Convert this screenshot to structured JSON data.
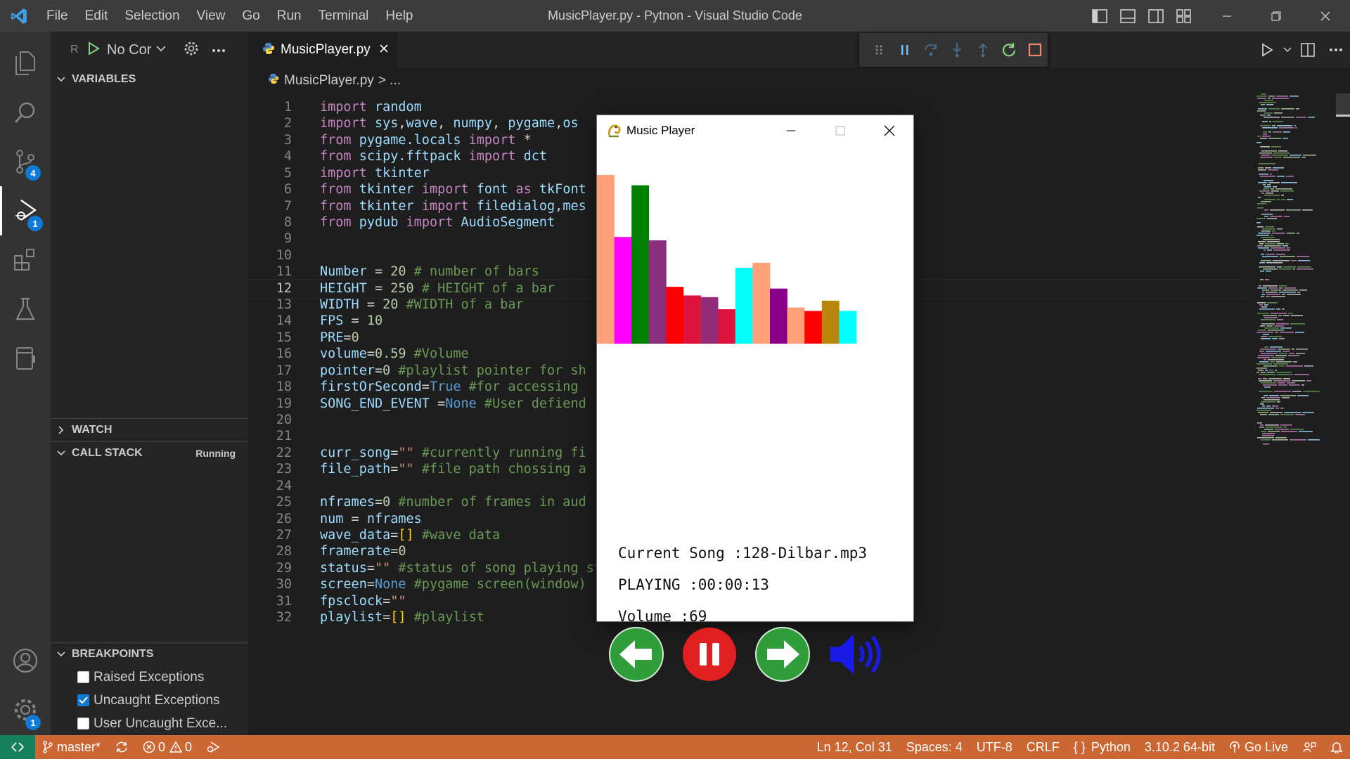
{
  "titlebar": {
    "menu": [
      "File",
      "Edit",
      "Selection",
      "View",
      "Go",
      "Run",
      "Terminal",
      "Help"
    ],
    "window_title": "MusicPlayer.py - Pytnon - Visual Studio Code"
  },
  "activity_bar": {
    "source_control_badge": "4",
    "run_debug_badge": "1",
    "manage_badge": "1"
  },
  "sidebar": {
    "run_prefix": "R",
    "run_config": "No Cor",
    "sections": {
      "variables": "VARIABLES",
      "watch": "WATCH",
      "call_stack": "CALL STACK",
      "call_stack_status": "Running",
      "breakpoints": "BREAKPOINTS"
    },
    "breakpoints": [
      {
        "label": "Raised Exceptions",
        "checked": false
      },
      {
        "label": "Uncaught Exceptions",
        "checked": true
      },
      {
        "label": "User Uncaught Exce...",
        "checked": false
      }
    ]
  },
  "editor": {
    "tab_label": "MusicPlayer.py",
    "breadcrumb_file": "MusicPlayer.py",
    "breadcrumb_rest": "> ...",
    "current_line": 12,
    "lines": [
      {
        "n": "1",
        "tokens": [
          [
            "kw",
            "import"
          ],
          [
            "op",
            " "
          ],
          [
            "id",
            "random"
          ]
        ]
      },
      {
        "n": "2",
        "tokens": [
          [
            "kw",
            "import"
          ],
          [
            "op",
            " "
          ],
          [
            "id",
            "sys"
          ],
          [
            "op",
            ","
          ],
          [
            "id",
            "wave"
          ],
          [
            "op",
            ", "
          ],
          [
            "id",
            "numpy"
          ],
          [
            "op",
            ", "
          ],
          [
            "id",
            "pygame"
          ],
          [
            "op",
            ","
          ],
          [
            "id",
            "os"
          ]
        ]
      },
      {
        "n": "3",
        "tokens": [
          [
            "kw",
            "from"
          ],
          [
            "op",
            " "
          ],
          [
            "id",
            "pygame.locals"
          ],
          [
            "op",
            " "
          ],
          [
            "kw",
            "import"
          ],
          [
            "op",
            " *"
          ]
        ]
      },
      {
        "n": "4",
        "tokens": [
          [
            "kw",
            "from"
          ],
          [
            "op",
            " "
          ],
          [
            "id",
            "scipy.fftpack"
          ],
          [
            "op",
            " "
          ],
          [
            "kw",
            "import"
          ],
          [
            "op",
            " "
          ],
          [
            "id",
            "dct"
          ]
        ]
      },
      {
        "n": "5",
        "tokens": [
          [
            "kw",
            "import"
          ],
          [
            "op",
            " "
          ],
          [
            "id",
            "tkinter"
          ]
        ]
      },
      {
        "n": "6",
        "tokens": [
          [
            "kw",
            "from"
          ],
          [
            "op",
            " "
          ],
          [
            "id",
            "tkinter"
          ],
          [
            "op",
            " "
          ],
          [
            "kw",
            "import"
          ],
          [
            "op",
            " "
          ],
          [
            "id",
            "font"
          ],
          [
            "op",
            " "
          ],
          [
            "kw",
            "as"
          ],
          [
            "op",
            " "
          ],
          [
            "id",
            "tkFont"
          ]
        ]
      },
      {
        "n": "7",
        "tokens": [
          [
            "kw",
            "from"
          ],
          [
            "op",
            " "
          ],
          [
            "id",
            "tkinter"
          ],
          [
            "op",
            " "
          ],
          [
            "kw",
            "import"
          ],
          [
            "op",
            " "
          ],
          [
            "id",
            "filedialog"
          ],
          [
            "op",
            ","
          ],
          [
            "id",
            "mes"
          ]
        ]
      },
      {
        "n": "8",
        "tokens": [
          [
            "kw",
            "from"
          ],
          [
            "op",
            " "
          ],
          [
            "id",
            "pydub"
          ],
          [
            "op",
            " "
          ],
          [
            "kw",
            "import"
          ],
          [
            "op",
            " "
          ],
          [
            "id",
            "AudioSegment"
          ]
        ]
      },
      {
        "n": "9",
        "tokens": []
      },
      {
        "n": "10",
        "tokens": []
      },
      {
        "n": "11",
        "tokens": [
          [
            "id",
            "Number"
          ],
          [
            "op",
            " = "
          ],
          [
            "nm",
            "20"
          ],
          [
            "op",
            " "
          ],
          [
            "cm",
            "# number of bars"
          ]
        ]
      },
      {
        "n": "12",
        "tokens": [
          [
            "id",
            "HEIGHT"
          ],
          [
            "op",
            " = "
          ],
          [
            "nm",
            "250"
          ],
          [
            "op",
            " "
          ],
          [
            "cm",
            "# HEIGHT of a bar"
          ]
        ]
      },
      {
        "n": "13",
        "tokens": [
          [
            "id",
            "WIDTH"
          ],
          [
            "op",
            " = "
          ],
          [
            "nm",
            "20"
          ],
          [
            "op",
            " "
          ],
          [
            "cm",
            "#WIDTH of a bar"
          ]
        ]
      },
      {
        "n": "14",
        "tokens": [
          [
            "id",
            "FPS"
          ],
          [
            "op",
            " = "
          ],
          [
            "nm",
            "10"
          ]
        ]
      },
      {
        "n": "15",
        "tokens": [
          [
            "id",
            "PRE"
          ],
          [
            "op",
            "="
          ],
          [
            "nm",
            "0"
          ]
        ]
      },
      {
        "n": "16",
        "tokens": [
          [
            "id",
            "volume"
          ],
          [
            "op",
            "="
          ],
          [
            "nm",
            "0.59"
          ],
          [
            "op",
            " "
          ],
          [
            "cm",
            "#Volume"
          ]
        ]
      },
      {
        "n": "17",
        "tokens": [
          [
            "id",
            "pointer"
          ],
          [
            "op",
            "="
          ],
          [
            "nm",
            "0"
          ],
          [
            "op",
            " "
          ],
          [
            "cm",
            "#playlist pointer for sh"
          ]
        ]
      },
      {
        "n": "18",
        "tokens": [
          [
            "id",
            "firstOrSecond"
          ],
          [
            "op",
            "="
          ],
          [
            "bl",
            "True"
          ],
          [
            "op",
            " "
          ],
          [
            "cm",
            "#for accessing"
          ],
          [
            "op",
            "                              "
          ],
          [
            "cm",
            "s"
          ]
        ]
      },
      {
        "n": "19",
        "tokens": [
          [
            "id",
            "SONG_END_EVENT"
          ],
          [
            "op",
            " ="
          ],
          [
            "bl",
            "None"
          ],
          [
            "op",
            " "
          ],
          [
            "cm",
            "#User defiend"
          ]
        ]
      },
      {
        "n": "20",
        "tokens": []
      },
      {
        "n": "21",
        "tokens": []
      },
      {
        "n": "22",
        "tokens": [
          [
            "id",
            "curr_song"
          ],
          [
            "op",
            "="
          ],
          [
            "st",
            "\"\""
          ],
          [
            "op",
            " "
          ],
          [
            "cm",
            "#currently running fi"
          ]
        ]
      },
      {
        "n": "23",
        "tokens": [
          [
            "id",
            "file_path"
          ],
          [
            "op",
            "="
          ],
          [
            "st",
            "\"\""
          ],
          [
            "op",
            " "
          ],
          [
            "cm",
            "#file path chossing a"
          ]
        ]
      },
      {
        "n": "24",
        "tokens": []
      },
      {
        "n": "25",
        "tokens": [
          [
            "id",
            "nframes"
          ],
          [
            "op",
            "="
          ],
          [
            "nm",
            "0"
          ],
          [
            "op",
            " "
          ],
          [
            "cm",
            "#number of frames in aud"
          ]
        ]
      },
      {
        "n": "26",
        "tokens": [
          [
            "id",
            "num"
          ],
          [
            "op",
            " = "
          ],
          [
            "id",
            "nframes"
          ]
        ]
      },
      {
        "n": "27",
        "tokens": [
          [
            "id",
            "wave_data"
          ],
          [
            "op",
            "="
          ],
          [
            "br",
            "[]"
          ],
          [
            "op",
            " "
          ],
          [
            "cm",
            "#wave data"
          ]
        ]
      },
      {
        "n": "28",
        "tokens": [
          [
            "id",
            "framerate"
          ],
          [
            "op",
            "="
          ],
          [
            "nm",
            "0"
          ]
        ]
      },
      {
        "n": "29",
        "tokens": [
          [
            "id",
            "status"
          ],
          [
            "op",
            "="
          ],
          [
            "st",
            "\"\""
          ],
          [
            "op",
            " "
          ],
          [
            "cm",
            "#status of song playing stopped paused"
          ]
        ]
      },
      {
        "n": "30",
        "tokens": [
          [
            "id",
            "screen"
          ],
          [
            "op",
            "="
          ],
          [
            "bl",
            "None"
          ],
          [
            "op",
            " "
          ],
          [
            "cm",
            "#pygame screen(window)"
          ]
        ]
      },
      {
        "n": "31",
        "tokens": [
          [
            "id",
            "fpsclock"
          ],
          [
            "op",
            "="
          ],
          [
            "st",
            "\"\""
          ]
        ]
      },
      {
        "n": "32",
        "tokens": [
          [
            "id",
            "playlist"
          ],
          [
            "op",
            "="
          ],
          [
            "br",
            "[]"
          ],
          [
            "op",
            " "
          ],
          [
            "cm",
            "#playlist"
          ]
        ]
      }
    ]
  },
  "music_player": {
    "title": "Music Player",
    "current_song": "Current Song :128-Dilbar.mp3",
    "playing": "PLAYING :00:00:13",
    "volume": "Volume :69",
    "bars": [
      {
        "value": 0.98,
        "color": "#ffa07a"
      },
      {
        "value": 0.62,
        "color": "#ff00ff"
      },
      {
        "value": 0.92,
        "color": "#008000"
      },
      {
        "value": 0.6,
        "color": "#8b2e7f"
      },
      {
        "value": 0.33,
        "color": "#ff0000"
      },
      {
        "value": 0.28,
        "color": "#dc143c"
      },
      {
        "value": 0.27,
        "color": "#922b7a"
      },
      {
        "value": 0.2,
        "color": "#dc143c"
      },
      {
        "value": 0.44,
        "color": "#00ffff"
      },
      {
        "value": 0.47,
        "color": "#ffa07a"
      },
      {
        "value": 0.32,
        "color": "#8b008b"
      },
      {
        "value": 0.21,
        "color": "#ffa07a"
      },
      {
        "value": 0.19,
        "color": "#ff0000"
      },
      {
        "value": 0.25,
        "color": "#b8860b"
      },
      {
        "value": 0.19,
        "color": "#00ffff"
      }
    ]
  },
  "statusbar": {
    "branch": "master*",
    "errors": "0",
    "warnings": "0",
    "position": "Ln 12, Col 31",
    "spaces": "Spaces: 4",
    "encoding": "UTF-8",
    "eol": "CRLF",
    "language": "Python",
    "interpreter": "3.10.2 64-bit",
    "go_live": "Go Live"
  },
  "colors": {
    "status_bar": "#cc6633",
    "remote": "#16825d",
    "accent": "#0e7bd6"
  }
}
